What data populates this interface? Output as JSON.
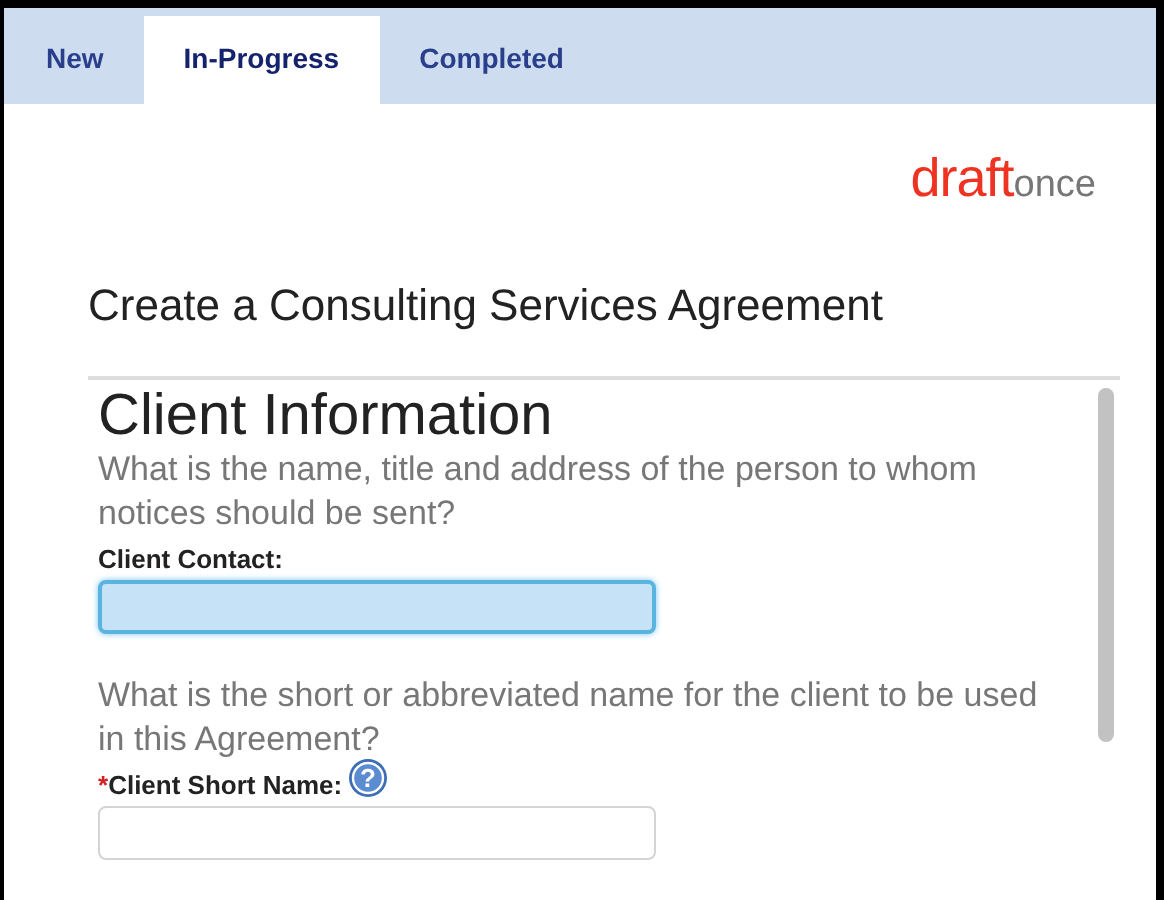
{
  "tabs": [
    {
      "label": "New",
      "selected": false
    },
    {
      "label": "In-Progress",
      "selected": true
    },
    {
      "label": "Completed",
      "selected": false
    }
  ],
  "logo": {
    "primary": "draft",
    "secondary": "once"
  },
  "page_title": "Create a Consulting Services Agreement",
  "section": {
    "heading": "Client Information",
    "fields": [
      {
        "question": "What is the name, title and address of the person to whom notices should be sent?",
        "label": "Client Contact:",
        "focused": true
      },
      {
        "question": "What is the short or abbreviated name for the client to be used in this Agreement?",
        "label": "Client Short Name:",
        "required_mark": "*",
        "help_icon": "?",
        "focused": false
      }
    ]
  }
}
